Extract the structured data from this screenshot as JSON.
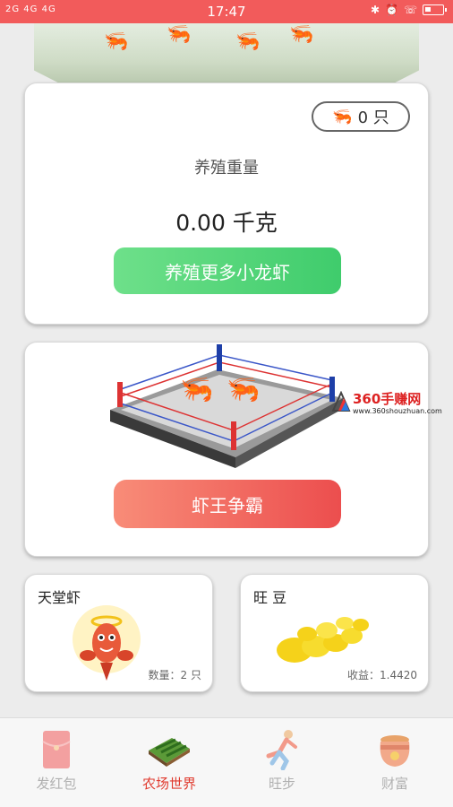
{
  "status_bar": {
    "signal_text": "2G 4G 4G",
    "time": "17:47",
    "icons": [
      "bluetooth-icon",
      "alarm-icon",
      "volte-icon",
      "battery-icon"
    ]
  },
  "farm": {
    "shrimp_count": "0 只",
    "weight_label": "养殖重量",
    "weight_value": "0.00 千克",
    "button_label": "养殖更多小龙虾"
  },
  "arena": {
    "button_label": "虾王争霸",
    "watermark_main": "360手赚网",
    "watermark_sub": "www.360shouzhuan.com"
  },
  "paradise": {
    "title": "天堂虾",
    "meta": "数量：2 只"
  },
  "beans": {
    "title": "旺 豆",
    "meta": "收益：1.4420"
  },
  "nav": {
    "items": [
      {
        "label": "发红包",
        "icon": "red-envelope-icon",
        "active": false
      },
      {
        "label": "农场世界",
        "icon": "farm-field-icon",
        "active": true
      },
      {
        "label": "旺步",
        "icon": "runner-icon",
        "active": false
      },
      {
        "label": "财富",
        "icon": "treasure-pot-icon",
        "active": false
      }
    ]
  },
  "colors": {
    "status_bar": "#f25b5b",
    "green_button": "#3fcc6c",
    "red_button": "#ec4e4e",
    "nav_active": "#e03a2e",
    "nav_inactive": "#b0b0b0"
  }
}
